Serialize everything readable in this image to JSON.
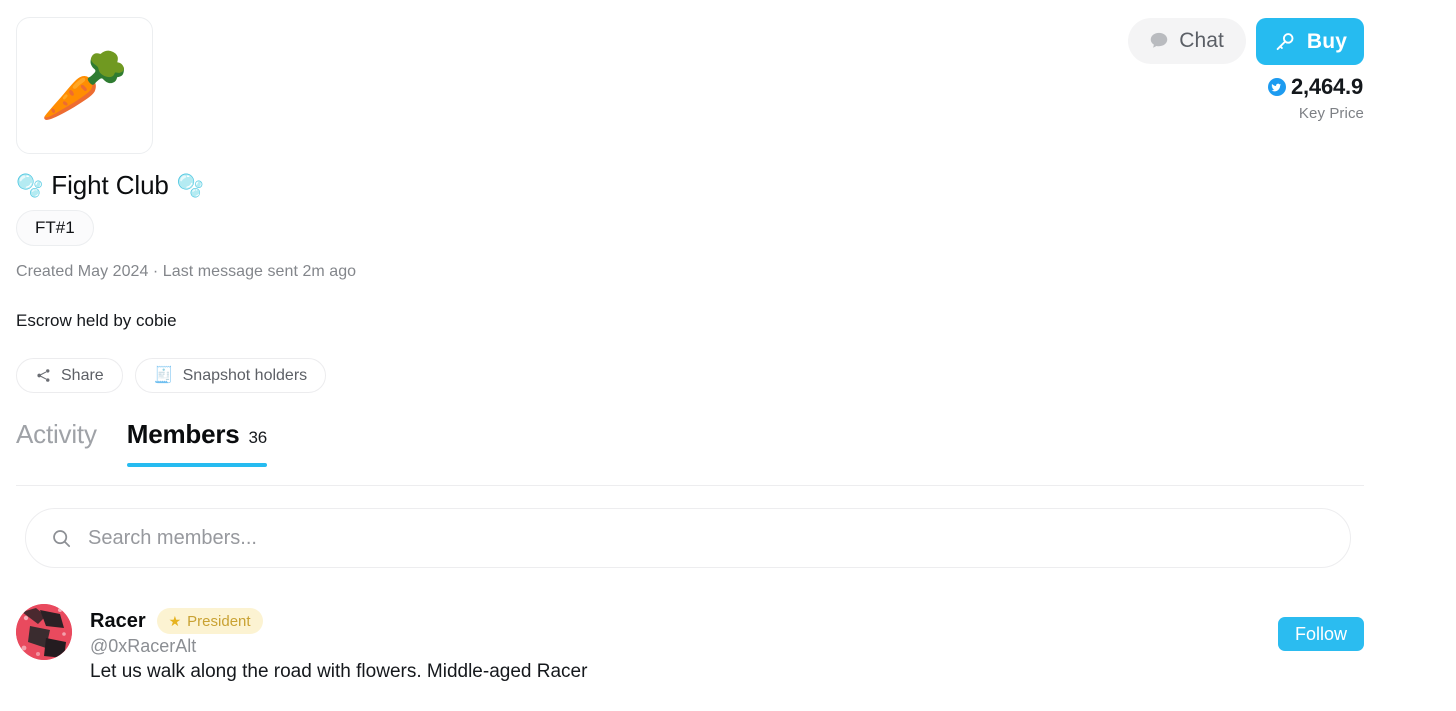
{
  "header": {
    "avatar_emoji": "🥕",
    "title_text": "Fight Club",
    "title_emoji_left": "🫧",
    "title_emoji_right": "🫧",
    "ft_badge": "FT#1",
    "meta": "Created May 2024 · Last message sent 2m ago",
    "escrow": "Escrow held by cobie"
  },
  "top_actions": {
    "chat_label": "Chat",
    "chat_icon": "chat-bubble-icon",
    "buy_label": "Buy",
    "buy_icon": "key-icon",
    "key_price_value": "2,464.9",
    "key_price_label": "Key Price",
    "key_price_coin_icon": "coin-icon",
    "buy_color": "#26bbf0"
  },
  "pills": [
    {
      "label": "Share",
      "icon": "share-icon"
    },
    {
      "label": "Snapshot holders",
      "icon": "scroll-icon",
      "emoji": "🧾"
    }
  ],
  "tabs": [
    {
      "label": "Activity",
      "count": "",
      "active": false
    },
    {
      "label": "Members",
      "count": "36",
      "active": true
    }
  ],
  "search": {
    "placeholder": "Search members...",
    "value": "",
    "icon": "search-icon"
  },
  "members": [
    {
      "name": "Racer",
      "role": "President",
      "role_icon": "star-icon",
      "handle": "@0xRacerAlt",
      "bio": "Let us walk along the road with flowers. Middle-aged Racer",
      "follow_label": "Follow"
    }
  ],
  "colors": {
    "accent": "#26bbf0",
    "badge_bg": "#fcf3d2",
    "badge_text": "#c9a233",
    "muted_text": "#83868b"
  }
}
